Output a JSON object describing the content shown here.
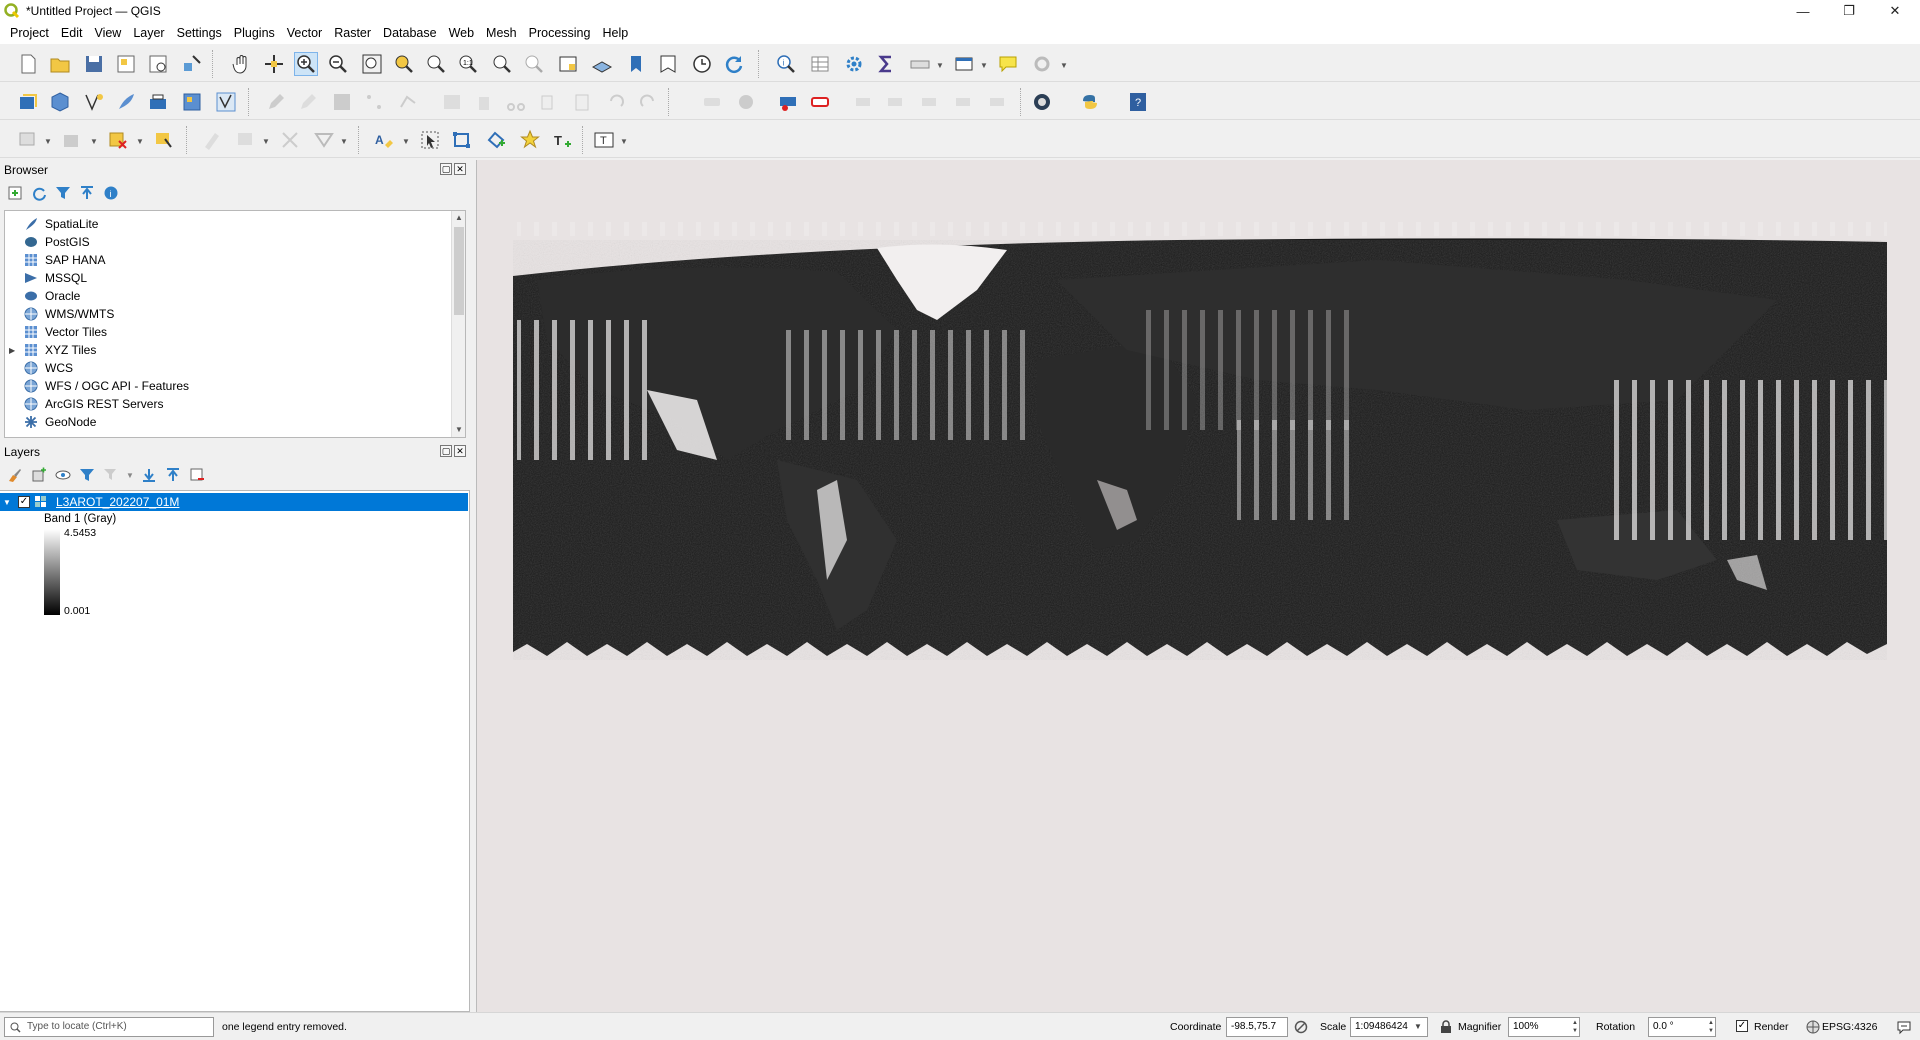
{
  "window": {
    "title": "*Untitled Project — QGIS"
  },
  "menu": [
    "Project",
    "Edit",
    "View",
    "Layer",
    "Settings",
    "Plugins",
    "Vector",
    "Raster",
    "Database",
    "Web",
    "Mesh",
    "Processing",
    "Help"
  ],
  "browser": {
    "title": "Browser",
    "items": [
      {
        "label": "SpatiaLite",
        "icon": "feather-icon"
      },
      {
        "label": "PostGIS",
        "icon": "elephant-icon"
      },
      {
        "label": "SAP HANA",
        "icon": "grid-icon"
      },
      {
        "label": "MSSQL",
        "icon": "mssql-icon"
      },
      {
        "label": "Oracle",
        "icon": "oracle-icon"
      },
      {
        "label": "WMS/WMTS",
        "icon": "globe-icon"
      },
      {
        "label": "Vector Tiles",
        "icon": "tiles-icon"
      },
      {
        "label": "XYZ Tiles",
        "icon": "tiles-icon"
      },
      {
        "label": "WCS",
        "icon": "globe-icon"
      },
      {
        "label": "WFS / OGC API - Features",
        "icon": "globe-icon"
      },
      {
        "label": "ArcGIS REST Servers",
        "icon": "globe-icon"
      },
      {
        "label": "GeoNode",
        "icon": "geonode-icon"
      }
    ]
  },
  "layers": {
    "title": "Layers",
    "layer_name": "L3AROT_202207_01M",
    "band": "Band 1 (Gray)",
    "max": "4.5453",
    "min": "0.001"
  },
  "status": {
    "locate_placeholder": "Type to locate (Ctrl+K)",
    "message": "one legend entry removed.",
    "coordinate_label": "Coordinate",
    "coordinate": "-98.5,75.7",
    "scale_label": "Scale",
    "scale": "1:09486424",
    "magnifier_label": "Magnifier",
    "magnifier": "100%",
    "rotation_label": "Rotation",
    "rotation": "0.0 °",
    "render_label": "Render",
    "crs": "EPSG:4326"
  },
  "colors": {
    "selection": "#0078d7",
    "canvas_bg": "#e8e3e3",
    "qgis_green": "#93b023"
  }
}
